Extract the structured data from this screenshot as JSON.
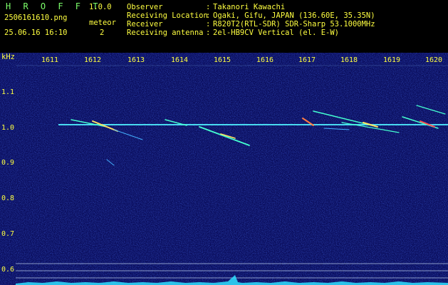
{
  "header": {
    "app_title": "H R O F F T",
    "app_version": "1.0.0",
    "filename": "2506161610.png",
    "mode_label": "meteor",
    "datetime": "25.06.16 16:10",
    "mode_count": "2",
    "info": [
      {
        "key": "Observer",
        "value": "Takanori Kawachi"
      },
      {
        "key": "Receiving Location",
        "value": "Ogaki, Gifu, JAPAN (136.60E, 35.35N)"
      },
      {
        "key": "Receiver",
        "value": "R820T2(RTL-SDR) SDR-Sharp 53.1000MHz"
      },
      {
        "key": "Receiving antenna",
        "value": "2el-HB9CV Vertical (el. E-W)"
      }
    ]
  },
  "axis": {
    "unit": "kHz",
    "y_ticks": [
      "1.1",
      "1.0",
      "0.9",
      "0.8",
      "0.7",
      "0.6"
    ],
    "x_ticks": [
      "1611",
      "1612",
      "1613",
      "1614",
      "1615",
      "1616",
      "1617",
      "1618",
      "1619",
      "1620"
    ]
  },
  "colors": {
    "background": "#0a0d5c",
    "text": "#ffff40",
    "signal": "#4ff0ff",
    "meteor_head": "#ffe060"
  }
}
